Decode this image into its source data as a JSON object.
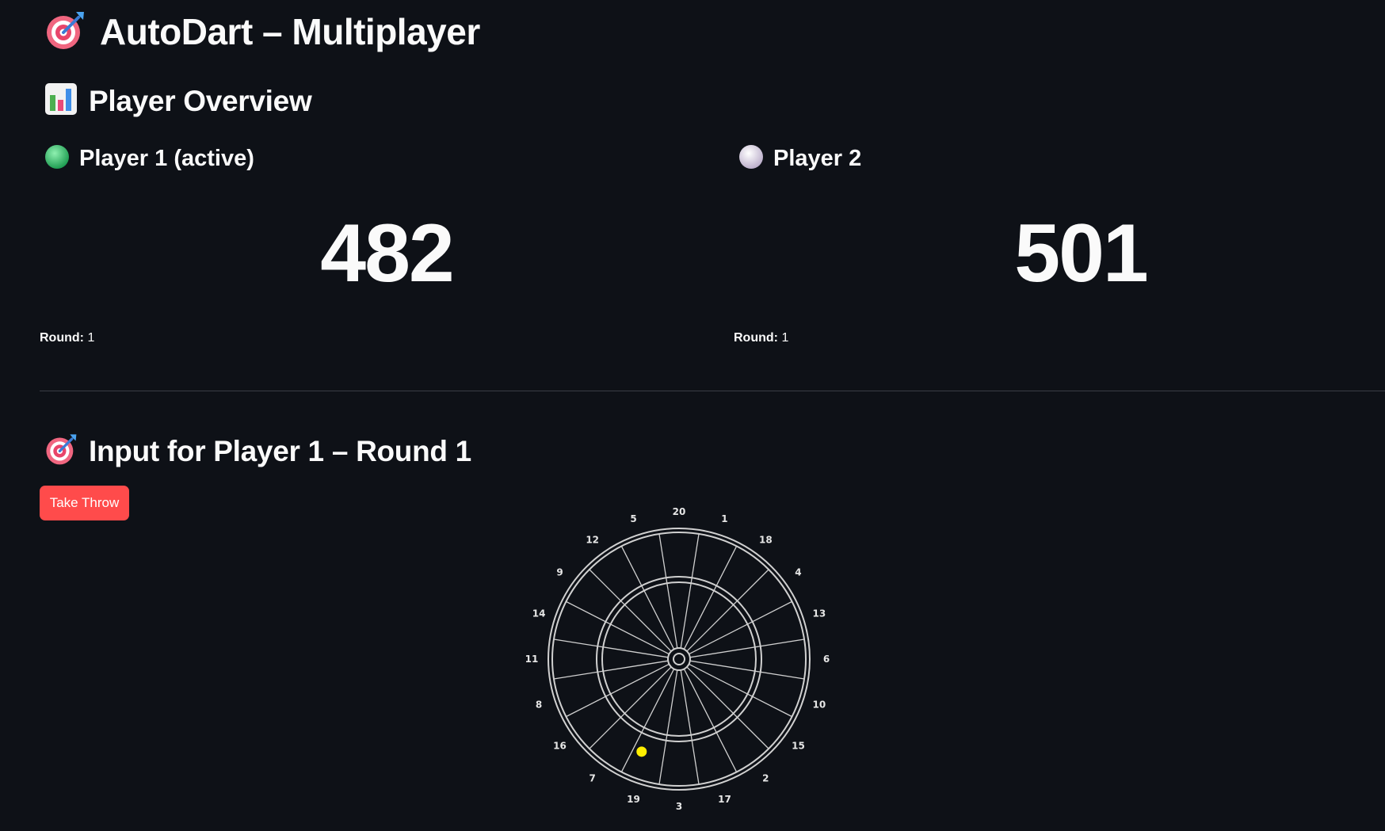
{
  "app": {
    "title": "AutoDart – Multiplayer",
    "title_icon": "dartboard-target-icon"
  },
  "overview": {
    "heading": "Player Overview",
    "heading_icon": "bar-chart-icon"
  },
  "players": [
    {
      "name": "Player 1 (active)",
      "indicator_icon": "green-circle-icon",
      "indicator_color": "#2ecc71",
      "score": "482",
      "round_label": "Round:",
      "round_value": "1"
    },
    {
      "name": "Player 2",
      "indicator_icon": "white-circle-icon",
      "indicator_color": "#e8e0f0",
      "score": "501",
      "round_label": "Round:",
      "round_value": "1"
    }
  ],
  "input_section": {
    "heading": "Input for Player 1 – Round 1",
    "heading_icon": "dartboard-target-icon",
    "button_label": "Take Throw",
    "button_color": "#ff4b4b"
  },
  "dartboard": {
    "numbers": [
      "20",
      "1",
      "18",
      "4",
      "13",
      "6",
      "10",
      "15",
      "2",
      "17",
      "3",
      "19",
      "7",
      "16",
      "8",
      "11",
      "14",
      "9",
      "12",
      "5"
    ],
    "line_color": "#d0d0d0",
    "dart_marker_color": "#ffee00"
  }
}
